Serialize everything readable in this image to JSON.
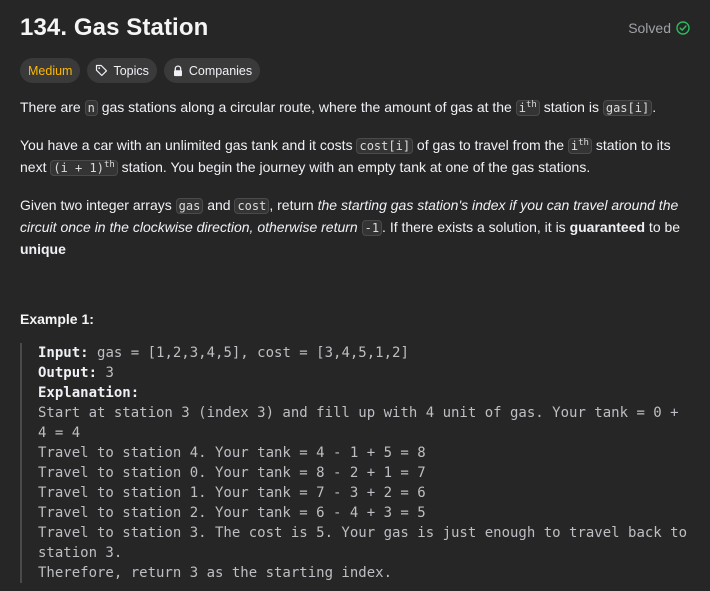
{
  "problem": {
    "title": "134. Gas Station",
    "status": "Solved"
  },
  "tags": {
    "difficulty": "Medium",
    "topics": "Topics",
    "companies": "Companies"
  },
  "description": {
    "p1": {
      "t1": "There are ",
      "c1": "n",
      "t2": " gas stations along a circular route, where the amount of gas at the ",
      "c2_base": "i",
      "c2_sup": "th",
      "t3": " station is ",
      "c3": "gas[i]",
      "t4": "."
    },
    "p2": {
      "t1": "You have a car with an unlimited gas tank and it costs ",
      "c1": "cost[i]",
      "t2": " of gas to travel from the ",
      "c2_base": "i",
      "c2_sup": "th",
      "t3": " station to its next ",
      "c3_base": "(i + 1)",
      "c3_sup": "th",
      "t4": " station. You begin the journey with an empty tank at one of the gas stations."
    },
    "p3": {
      "t1": "Given two integer arrays ",
      "c1": "gas",
      "t2": " and ",
      "c2": "cost",
      "t3": ", return ",
      "em1": "the starting gas station's index if you can travel around the circuit once in the clockwise direction, otherwise return",
      "c3": "-1",
      "t4": ". If there exists a solution, it is ",
      "b1": "guaranteed",
      "t5": " to be ",
      "b2": "unique"
    }
  },
  "example1": {
    "title": "Example 1:",
    "input_label": "Input:",
    "input_value": "gas = [1,2,3,4,5], cost = [3,4,5,1,2]",
    "output_label": "Output:",
    "output_value": "3",
    "explanation_label": "Explanation:",
    "lines": [
      "Start at station 3 (index 3) and fill up with 4 unit of gas. Your tank = 0 + 4 = 4",
      "Travel to station 4. Your tank = 4 - 1 + 5 = 8",
      "Travel to station 0. Your tank = 8 - 2 + 1 = 7",
      "Travel to station 1. Your tank = 7 - 3 + 2 = 6",
      "Travel to station 2. Your tank = 6 - 4 + 3 = 5",
      "Travel to station 3. The cost is 5. Your gas is just enough to travel back to station 3.",
      "Therefore, return 3 as the starting index."
    ]
  },
  "colors": {
    "background": "#262626",
    "difficulty_medium": "#ffb800",
    "solved_check": "#2cbb5d"
  },
  "icons": {
    "solved": "check-circle-icon",
    "topics": "tag-icon",
    "companies": "lock-icon"
  }
}
